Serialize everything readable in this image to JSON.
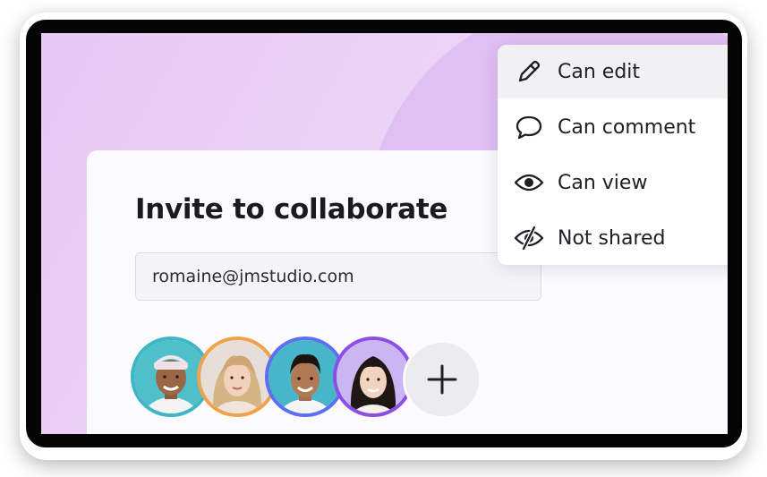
{
  "dialog": {
    "title": "Invite to collaborate",
    "email_value": "romaine@jmstudio.com"
  },
  "permissions_menu": {
    "items": [
      {
        "label": "Can edit",
        "icon": "pencil-icon",
        "selected": true
      },
      {
        "label": "Can comment",
        "icon": "speech-bubble-icon",
        "selected": false
      },
      {
        "label": "Can view",
        "icon": "eye-icon",
        "selected": false
      },
      {
        "label": "Not shared",
        "icon": "eye-slash-icon",
        "selected": false
      }
    ]
  },
  "collaborators": [
    {
      "icon": "avatar",
      "ring_color": "#3fb6c4"
    },
    {
      "icon": "avatar",
      "ring_color": "#f0a24a"
    },
    {
      "icon": "avatar",
      "ring_color": "#5b6ff0"
    },
    {
      "icon": "avatar",
      "ring_color": "#8b4fe8"
    }
  ],
  "add_button": {
    "icon": "plus-icon"
  },
  "colors": {
    "background_purple": "#e7c9f3",
    "accent_purple": "#8b4fe8",
    "text_dark": "#1b1b1f"
  }
}
